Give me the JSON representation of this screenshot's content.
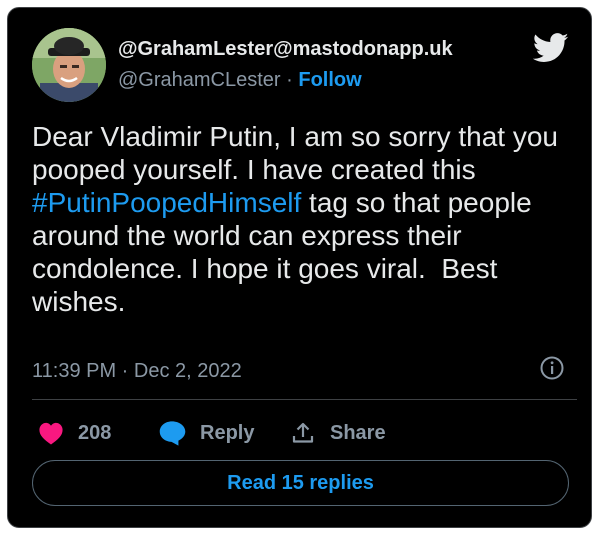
{
  "author": {
    "display_name": "@GrahamLester@mastodonapp.uk",
    "handle": "@GrahamCLester",
    "separator": " · ",
    "follow_label": "Follow",
    "avatar_icon": "avatar-photo"
  },
  "tweet": {
    "text_part1": "Dear Vladimir Putin, I am so sorry that you pooped yourself. I have created this ",
    "hashtag": "#PutinPoopedHimself",
    "text_part2": " tag so that people around the world can express their condolence. I hope it goes viral.  Best wishes.",
    "timestamp": "11:39 PM · Dec 2, 2022"
  },
  "actions": {
    "like_count": "208",
    "reply_label": "Reply",
    "share_label": "Share",
    "read_replies_label": "Read 15 replies"
  },
  "icons": {
    "brand": "twitter-bird-icon",
    "info": "info-icon",
    "like": "heart-icon",
    "reply": "speech-bubble-icon",
    "share": "share-upload-icon"
  },
  "colors": {
    "background": "#000000",
    "text": "#e7e9ea",
    "muted": "#8b98a5",
    "accent": "#1d9bf0",
    "like": "#f91880"
  }
}
